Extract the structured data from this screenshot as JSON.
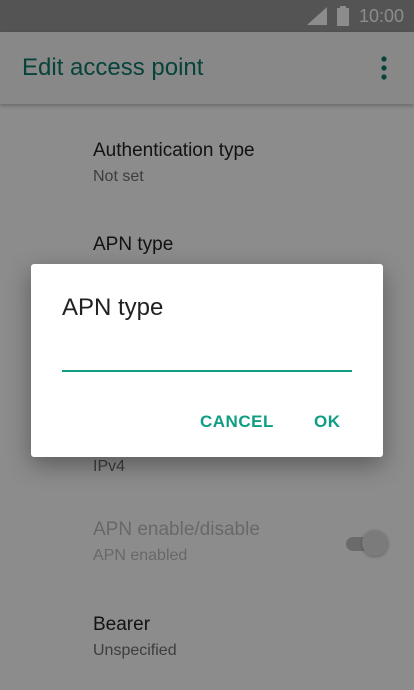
{
  "status_bar": {
    "time": "10:00",
    "signal_icon": "signal-icon",
    "battery_icon": "battery-icon"
  },
  "app_bar": {
    "title": "Edit access point",
    "menu_icon": "more-vert-icon"
  },
  "settings": [
    {
      "primary": "Authentication type",
      "secondary": "Not set"
    },
    {
      "primary": "APN type",
      "secondary": ""
    },
    {
      "primary": "",
      "secondary": "IPv4"
    },
    {
      "primary": "APN enable/disable",
      "secondary": "APN enabled"
    },
    {
      "primary": "Bearer",
      "secondary": "Unspecified"
    }
  ],
  "dialog": {
    "title": "APN type",
    "input_value": "",
    "cancel_label": "CANCEL",
    "ok_label": "OK"
  },
  "colors": {
    "accent": "#0f9d84",
    "title": "#0e7a6b"
  }
}
